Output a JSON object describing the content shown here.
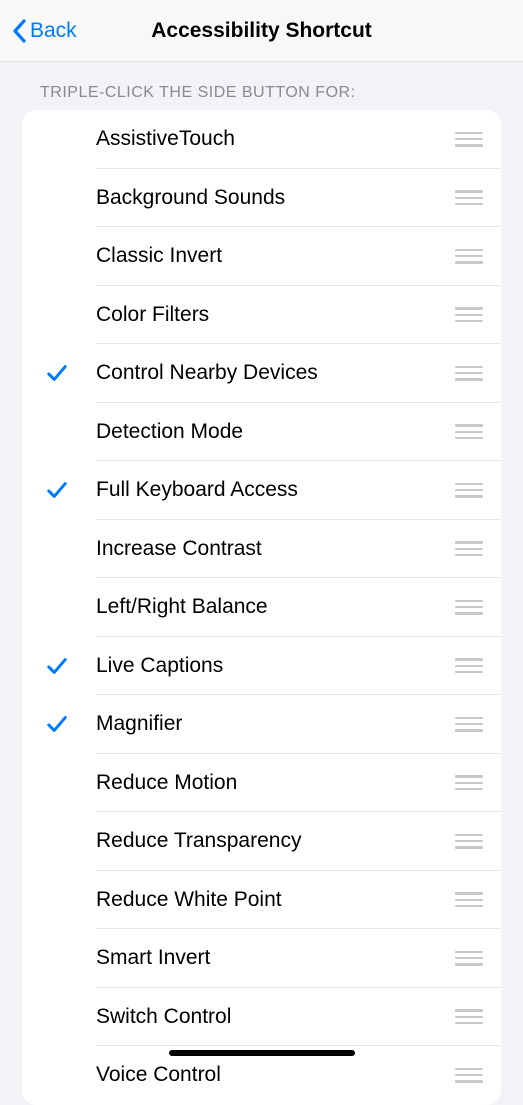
{
  "nav": {
    "back_label": "Back",
    "title": "Accessibility Shortcut"
  },
  "section": {
    "header": "TRIPLE-CLICK THE SIDE BUTTON FOR:"
  },
  "items": [
    {
      "label": "AssistiveTouch",
      "checked": false
    },
    {
      "label": "Background Sounds",
      "checked": false
    },
    {
      "label": "Classic Invert",
      "checked": false
    },
    {
      "label": "Color Filters",
      "checked": false
    },
    {
      "label": "Control Nearby Devices",
      "checked": true
    },
    {
      "label": "Detection Mode",
      "checked": false
    },
    {
      "label": "Full Keyboard Access",
      "checked": true
    },
    {
      "label": "Increase Contrast",
      "checked": false
    },
    {
      "label": "Left/Right Balance",
      "checked": false
    },
    {
      "label": "Live Captions",
      "checked": true
    },
    {
      "label": "Magnifier",
      "checked": true
    },
    {
      "label": "Reduce Motion",
      "checked": false
    },
    {
      "label": "Reduce Transparency",
      "checked": false
    },
    {
      "label": "Reduce White Point",
      "checked": false
    },
    {
      "label": "Smart Invert",
      "checked": false
    },
    {
      "label": "Switch Control",
      "checked": false
    },
    {
      "label": "Voice Control",
      "checked": false
    }
  ]
}
